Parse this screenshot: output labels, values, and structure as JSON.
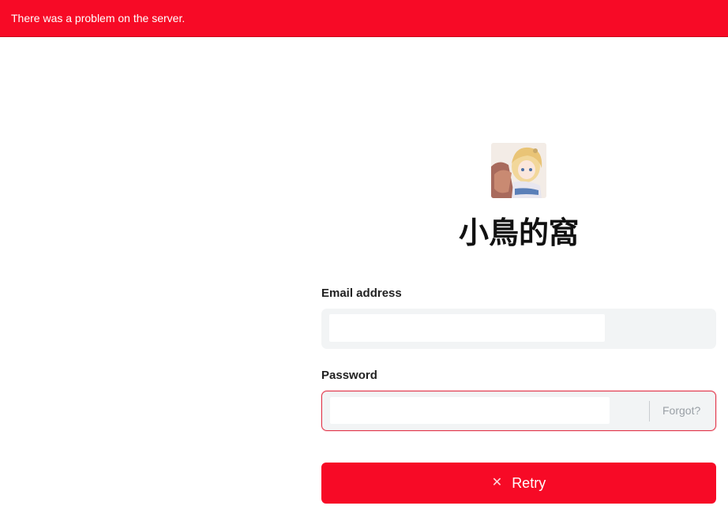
{
  "banner": {
    "message": "There was a problem on the server."
  },
  "site": {
    "title": "小鳥的窩",
    "logo_icon": "anime-avatar-logo"
  },
  "form": {
    "email": {
      "label": "Email address",
      "value": "",
      "placeholder": ""
    },
    "password": {
      "label": "Password",
      "value": "",
      "placeholder": "",
      "forgot_label": "Forgot?"
    },
    "submit": {
      "label": "Retry",
      "icon": "close-icon"
    }
  },
  "colors": {
    "error": "#f70a26",
    "field_bg": "#f2f4f5",
    "text": "#111111",
    "muted": "#9aa0a6"
  }
}
